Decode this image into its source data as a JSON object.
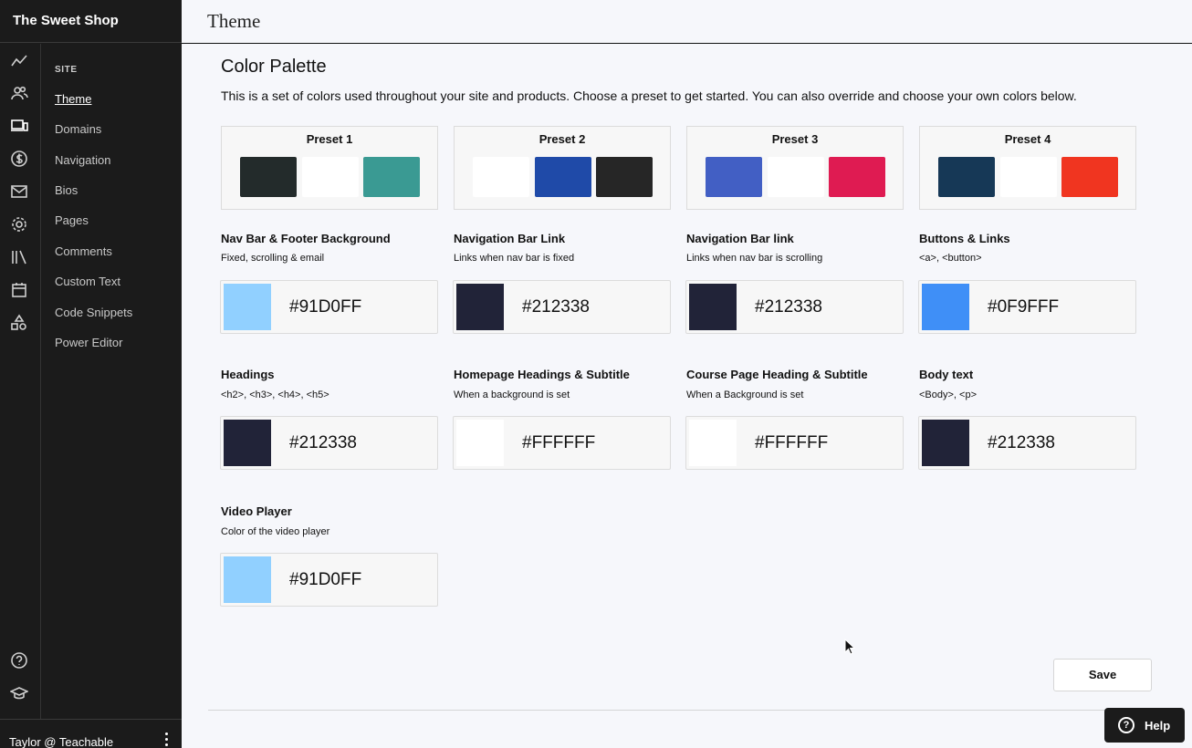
{
  "app": {
    "brand": "The Sweet Shop"
  },
  "header": {
    "title": "Theme"
  },
  "sidebar": {
    "heading": "SITE",
    "items": [
      {
        "label": "Theme"
      },
      {
        "label": "Domains"
      },
      {
        "label": "Navigation"
      },
      {
        "label": "Bios"
      },
      {
        "label": "Pages"
      },
      {
        "label": "Comments"
      },
      {
        "label": "Custom Text"
      },
      {
        "label": "Code Snippets"
      },
      {
        "label": "Power Editor"
      }
    ],
    "rail_icons": [
      "analytics-icon",
      "users-icon",
      "devices-icon",
      "dollar-icon",
      "mail-icon",
      "gear-icon",
      "library-icon",
      "calendar-icon",
      "shapes-icon",
      "help-circle-icon",
      "graduation-cap-icon"
    ]
  },
  "footer": {
    "user": "Taylor @ Teachable"
  },
  "palette": {
    "title": "Color Palette",
    "description": "This is a set of colors used throughout your site and products. Choose a preset to get started. You can also override and choose your own colors below.",
    "presets": [
      {
        "label": "Preset 1",
        "colors": [
          "#232b2b",
          "#ffffff",
          "#3a9a93"
        ]
      },
      {
        "label": "Preset 2",
        "colors": [
          "#ffffff",
          "#1f4aa8",
          "#262626"
        ]
      },
      {
        "label": "Preset 3",
        "colors": [
          "#425fc4",
          "#ffffff",
          "#df1b52"
        ]
      },
      {
        "label": "Preset 4",
        "colors": [
          "#163856",
          "#ffffff",
          "#f03520"
        ]
      }
    ],
    "fields": [
      {
        "label": "Nav Bar & Footer Background",
        "hint": "Fixed, scrolling & email",
        "hex": "#91D0FF",
        "color": "#91d0ff"
      },
      {
        "label": "Navigation Bar Link",
        "hint": "Links when nav bar is fixed",
        "hex": "#212338",
        "color": "#212338"
      },
      {
        "label": "Navigation Bar link",
        "hint": "Links when nav bar is scrolling",
        "hex": "#212338",
        "color": "#212338"
      },
      {
        "label": "Buttons & Links",
        "hint": "<a>, <button>",
        "hex": "#0F9FFF",
        "color": "#3f8ff7"
      },
      {
        "label": "Headings",
        "hint": "<h2>, <h3>, <h4>, <h5>",
        "hex": "#212338",
        "color": "#212338"
      },
      {
        "label": "Homepage Headings & Subtitle",
        "hint": "When a background is set",
        "hex": "#FFFFFF",
        "color": "#ffffff"
      },
      {
        "label": "Course Page Heading & Subtitle",
        "hint": "When a Background is set",
        "hex": "#FFFFFF",
        "color": "#ffffff"
      },
      {
        "label": "Body text",
        "hint": "<Body>, <p>",
        "hex": "#212338",
        "color": "#212338"
      },
      {
        "label": "Video Player",
        "hint": "Color of the video player",
        "hex": "#91D0FF",
        "color": "#91d0ff"
      }
    ]
  },
  "actions": {
    "save": "Save",
    "help": "Help"
  }
}
